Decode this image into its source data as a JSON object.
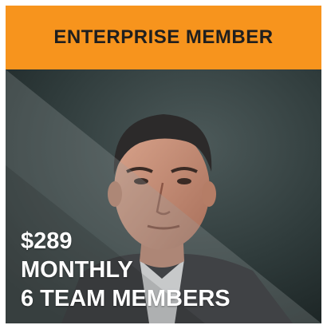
{
  "card": {
    "title": "ENTERPRISE MEMBER",
    "price": "$289",
    "billing_period": "MONTHLY",
    "team_size": "6 TEAM MEMBERS",
    "photo": "person-portrait-image"
  },
  "colors": {
    "header_bg": "#f7941d",
    "header_text": "#1f1f1f",
    "overlay_text": "#ffffff"
  }
}
